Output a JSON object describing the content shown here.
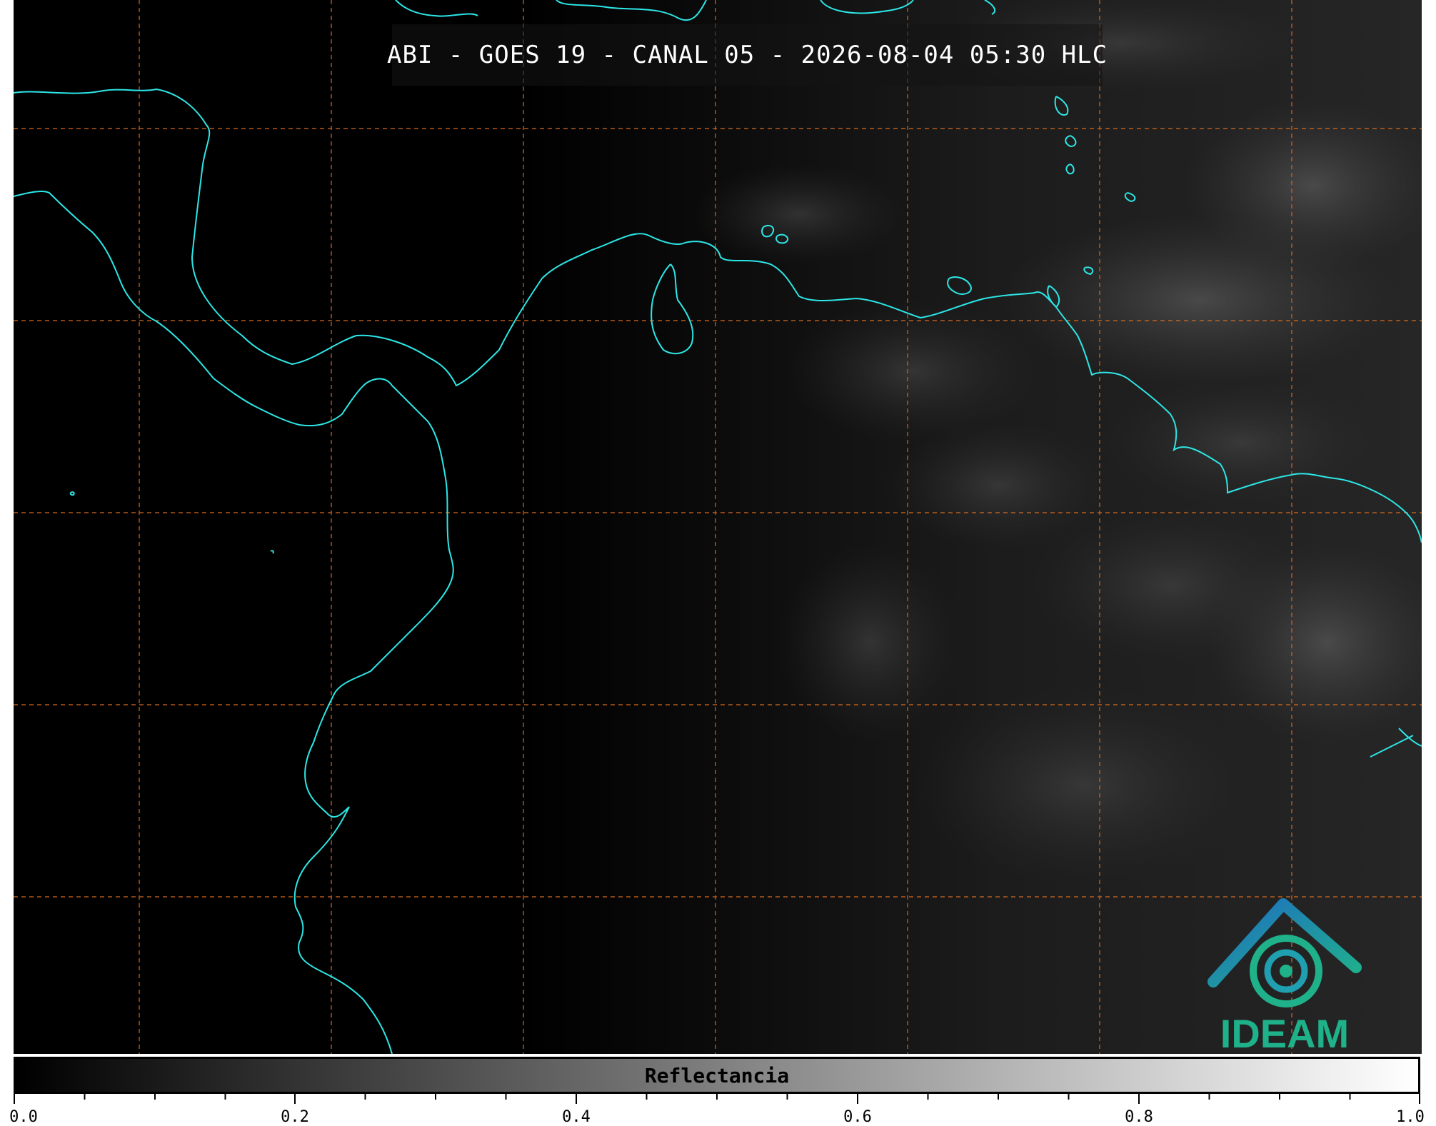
{
  "title": "ABI - GOES 19 - CANAL 05 - 2026-08-04 05:30 HLC",
  "colorbar": {
    "label": "Reflectancia",
    "ticks": [
      "0.0",
      "0.2",
      "0.4",
      "0.6",
      "0.8",
      "1.0"
    ],
    "range": [
      0.0,
      1.0
    ],
    "colormap": "grayscale black-to-white"
  },
  "logo": {
    "text": "IDEAM"
  },
  "colors": {
    "coastline": "#2de6e6",
    "gridlines": "#d2691e",
    "logo_text": "#1fb28a",
    "logo_roof": "#1f7fc1"
  }
}
